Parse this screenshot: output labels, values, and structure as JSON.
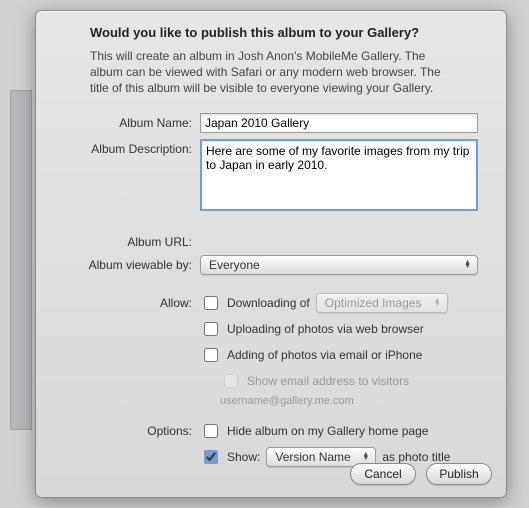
{
  "heading": "Would you like to publish this album to your Gallery?",
  "intro": "This will create an album in Josh Anon's MobileMe Gallery. The album can be viewed with Safari or any modern web browser. The title of this album will be visible to everyone viewing your Gallery.",
  "labels": {
    "album_name": "Album Name:",
    "album_description": "Album Description:",
    "album_url": "Album URL:",
    "viewable_by": "Album viewable by:",
    "allow": "Allow:",
    "options": "Options:"
  },
  "fields": {
    "album_name": "Japan 2010 Gallery",
    "album_description": "Here are some of my favorite images from my trip to Japan in early 2010.",
    "album_url": "",
    "viewable_by": "Everyone"
  },
  "allow": {
    "downloading_label": "Downloading of",
    "downloading_select": "Optimized Images",
    "uploading_label": "Uploading of photos via web browser",
    "adding_label": "Adding of photos via email or iPhone",
    "show_email_label": "Show email address to visitors",
    "email": "username@gallery.me.com"
  },
  "options": {
    "hide_label": "Hide album on my Gallery home page",
    "show_label": "Show:",
    "show_select": "Version Name",
    "show_suffix": "as photo title"
  },
  "buttons": {
    "cancel": "Cancel",
    "publish": "Publish"
  },
  "checks": {
    "downloading": false,
    "uploading": false,
    "adding": false,
    "show_email": false,
    "hide": false,
    "show": true
  }
}
